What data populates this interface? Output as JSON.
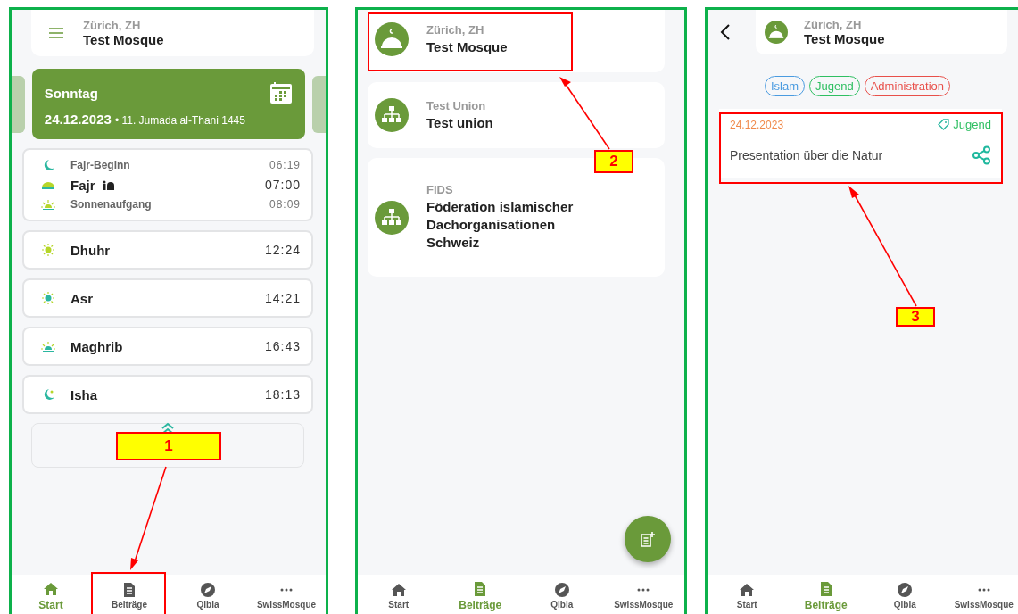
{
  "start_screen": {
    "header": {
      "location": "Zürich, ZH",
      "name": "Test Mosque"
    },
    "day_card": {
      "weekday": "Sonntag",
      "date": "24.12.2023",
      "hijri_date": "• 11. Jumada al-Thani 1445"
    },
    "prayer_cards": [
      {
        "rows": [
          {
            "kind": "sub",
            "name": "Fajr-Beginn",
            "time": "06:19",
            "mosque_mark": false
          },
          {
            "kind": "main",
            "name": "Fajr",
            "time": "07:00",
            "mosque_mark": true
          },
          {
            "kind": "sub",
            "name": "Sonnenaufgang",
            "time": "08:09",
            "mosque_mark": false
          }
        ]
      },
      {
        "rows": [
          {
            "kind": "main",
            "name": "Dhuhr",
            "time": "12:24",
            "mosque_mark": false
          }
        ]
      },
      {
        "rows": [
          {
            "kind": "main",
            "name": "Asr",
            "time": "14:21",
            "mosque_mark": false
          }
        ]
      },
      {
        "rows": [
          {
            "kind": "main",
            "name": "Maghrib",
            "time": "16:43",
            "mosque_mark": false
          }
        ]
      },
      {
        "rows": [
          {
            "kind": "main",
            "name": "Isha",
            "time": "18:13",
            "mosque_mark": false
          }
        ]
      }
    ],
    "nav": [
      {
        "label": "Start",
        "selected": true
      },
      {
        "label": "Beiträge",
        "selected": false
      },
      {
        "label": "Qibla",
        "selected": false
      },
      {
        "label": "SwissMosque",
        "selected": false
      }
    ],
    "annotation": {
      "label": "1"
    }
  },
  "posts_screen": {
    "organizations": [
      {
        "kind": "mosque",
        "subtitle": "Zürich, ZH",
        "title": "Test Mosque"
      },
      {
        "kind": "union",
        "subtitle": "Test Union",
        "title": "Test union"
      },
      {
        "kind": "union",
        "subtitle": "FIDS",
        "title": "Föderation islamischer Dachorganisationen Schweiz"
      }
    ],
    "nav": [
      {
        "label": "Start",
        "selected": false
      },
      {
        "label": "Beiträge",
        "selected": true
      },
      {
        "label": "Qibla",
        "selected": false
      },
      {
        "label": "SwissMosque",
        "selected": false
      }
    ],
    "annotation": {
      "label": "2"
    }
  },
  "feed_screen": {
    "header": {
      "location": "Zürich, ZH",
      "name": "Test Mosque"
    },
    "tags": [
      {
        "label": "Islam",
        "color": "#4a9be0"
      },
      {
        "label": "Jugend",
        "color": "#2fbf62"
      },
      {
        "label": "Administration",
        "color": "#e8504a"
      }
    ],
    "post": {
      "date": "24.12.2023",
      "tag": "Jugend",
      "title": "Presentation über die Natur"
    },
    "nav": [
      {
        "label": "Start",
        "selected": false
      },
      {
        "label": "Beiträge",
        "selected": true
      },
      {
        "label": "Qibla",
        "selected": false
      },
      {
        "label": "SwissMosque",
        "selected": false
      }
    ],
    "annotation": {
      "label": "3"
    }
  }
}
